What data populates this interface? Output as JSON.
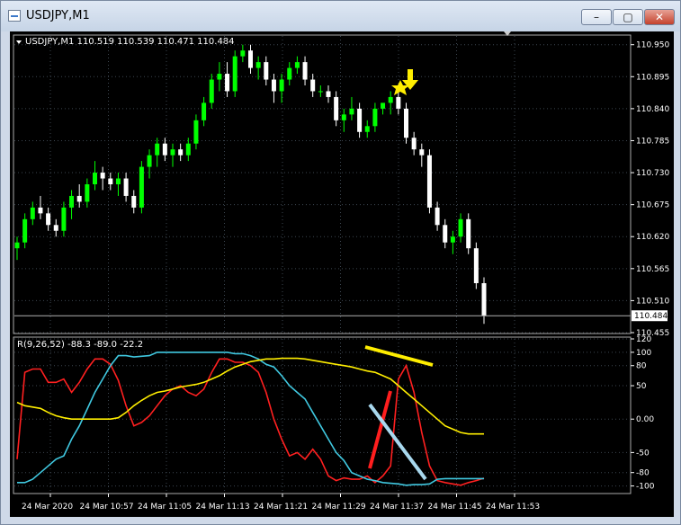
{
  "window": {
    "title": "USDJPY,M1",
    "minimize_glyph": "–",
    "maximize_glyph": "▢",
    "close_glyph": "✕"
  },
  "info_line": "USDJPY,M1  110.519 110.539 110.471 110.484",
  "indicator_label": "R(9,26,52) -88.3 -89.0 -22.2",
  "price_axis_labels": [
    "110.950",
    "110.895",
    "110.840",
    "110.785",
    "110.730",
    "110.675",
    "110.620",
    "110.565",
    "110.510",
    "110.455"
  ],
  "current_price": "110.484",
  "indicator_axis_labels": [
    "120",
    "100",
    "80",
    "50",
    "0.00",
    "-50",
    "-80",
    "-100"
  ],
  "time_axis_labels": [
    "24 Mar 2020",
    "24 Mar 10:57",
    "24 Mar 11:05",
    "24 Mar 11:13",
    "24 Mar 11:21",
    "24 Mar 11:29",
    "24 Mar 11:37",
    "24 Mar 11:45",
    "24 Mar 11:53"
  ],
  "colors": {
    "background": "#000000",
    "bull": "#00ff00",
    "bear": "#ffffff",
    "grid": "#3c4650",
    "axis_text": "#ffffff",
    "line_fast": "#ff2020",
    "line_mid": "#40c8e0",
    "line_slow": "#ffee00",
    "annotation_yellow": "#ffee00",
    "annotation_red": "#ff1e1e",
    "annotation_blue": "#a8d8ee"
  },
  "chart_data": {
    "type": "candlestick",
    "price_ylim": [
      110.455,
      110.965
    ],
    "candles": [
      [
        110.6,
        110.62,
        110.58,
        110.61
      ],
      [
        110.61,
        110.66,
        110.6,
        110.65
      ],
      [
        110.65,
        110.68,
        110.64,
        110.67
      ],
      [
        110.67,
        110.69,
        110.65,
        110.66
      ],
      [
        110.66,
        110.67,
        110.63,
        110.64
      ],
      [
        110.64,
        110.65,
        110.62,
        110.63
      ],
      [
        110.63,
        110.68,
        110.62,
        110.67
      ],
      [
        110.67,
        110.7,
        110.65,
        110.69
      ],
      [
        110.69,
        110.71,
        110.67,
        110.68
      ],
      [
        110.68,
        110.72,
        110.67,
        110.71
      ],
      [
        110.71,
        110.75,
        110.7,
        110.73
      ],
      [
        110.73,
        110.74,
        110.7,
        110.72
      ],
      [
        110.72,
        110.73,
        110.7,
        110.71
      ],
      [
        110.71,
        110.73,
        110.69,
        110.72
      ],
      [
        110.72,
        110.73,
        110.68,
        110.69
      ],
      [
        110.69,
        110.7,
        110.66,
        110.67
      ],
      [
        110.67,
        110.75,
        110.66,
        110.74
      ],
      [
        110.74,
        110.77,
        110.72,
        110.76
      ],
      [
        110.76,
        110.79,
        110.74,
        110.78
      ],
      [
        110.78,
        110.79,
        110.75,
        110.76
      ],
      [
        110.76,
        110.78,
        110.74,
        110.77
      ],
      [
        110.77,
        110.78,
        110.75,
        110.76
      ],
      [
        110.76,
        110.79,
        110.75,
        110.78
      ],
      [
        110.78,
        110.83,
        110.77,
        110.82
      ],
      [
        110.82,
        110.86,
        110.81,
        110.85
      ],
      [
        110.85,
        110.9,
        110.84,
        110.89
      ],
      [
        110.89,
        110.92,
        110.87,
        110.9
      ],
      [
        110.9,
        110.92,
        110.86,
        110.87
      ],
      [
        110.87,
        110.94,
        110.86,
        110.93
      ],
      [
        110.93,
        110.95,
        110.92,
        110.94
      ],
      [
        110.94,
        110.95,
        110.9,
        110.91
      ],
      [
        110.91,
        110.93,
        110.89,
        110.92
      ],
      [
        110.92,
        110.93,
        110.88,
        110.89
      ],
      [
        110.89,
        110.9,
        110.85,
        110.87
      ],
      [
        110.87,
        110.9,
        110.85,
        110.89
      ],
      [
        110.89,
        110.92,
        110.88,
        110.91
      ],
      [
        110.91,
        110.93,
        110.9,
        110.92
      ],
      [
        110.92,
        110.93,
        110.88,
        110.89
      ],
      [
        110.89,
        110.9,
        110.86,
        110.87
      ],
      [
        110.87,
        110.88,
        110.86,
        110.87
      ],
      [
        110.87,
        110.88,
        110.85,
        110.86
      ],
      [
        110.86,
        110.87,
        110.81,
        110.82
      ],
      [
        110.82,
        110.84,
        110.8,
        110.83
      ],
      [
        110.83,
        110.86,
        110.82,
        110.84
      ],
      [
        110.84,
        110.85,
        110.79,
        110.8
      ],
      [
        110.8,
        110.82,
        110.79,
        110.81
      ],
      [
        110.81,
        110.85,
        110.8,
        110.84
      ],
      [
        110.84,
        110.85,
        110.83,
        110.85
      ],
      [
        110.85,
        110.87,
        110.83,
        110.86
      ],
      [
        110.86,
        110.87,
        110.83,
        110.84
      ],
      [
        110.84,
        110.85,
        110.78,
        110.79
      ],
      [
        110.79,
        110.8,
        110.76,
        110.77
      ],
      [
        110.77,
        110.78,
        110.74,
        110.76
      ],
      [
        110.76,
        110.77,
        110.66,
        110.67
      ],
      [
        110.67,
        110.68,
        110.63,
        110.64
      ],
      [
        110.64,
        110.65,
        110.6,
        110.61
      ],
      [
        110.61,
        110.63,
        110.59,
        110.62
      ],
      [
        110.62,
        110.66,
        110.61,
        110.65
      ],
      [
        110.65,
        110.66,
        110.59,
        110.6
      ],
      [
        110.6,
        110.61,
        110.53,
        110.54
      ],
      [
        110.54,
        110.55,
        110.47,
        110.484
      ]
    ],
    "indicator": {
      "name": "R(9,26,52)",
      "ylim": [
        -110,
        120
      ],
      "series": [
        {
          "name": "R9",
          "color": "#ff2020",
          "values": [
            -60,
            70,
            75,
            75,
            55,
            55,
            60,
            40,
            55,
            75,
            90,
            90,
            82,
            58,
            20,
            -10,
            -5,
            5,
            20,
            35,
            45,
            50,
            40,
            35,
            45,
            70,
            90,
            90,
            85,
            85,
            80,
            70,
            40,
            0,
            -30,
            -55,
            -50,
            -60,
            -45,
            -60,
            -85,
            -92,
            -88,
            -90,
            -90,
            -85,
            -95,
            -85,
            -70,
            60,
            80,
            40,
            -20,
            -70,
            -92,
            -95,
            -97,
            -99,
            -95,
            -92,
            -88.3
          ]
        },
        {
          "name": "R26",
          "color": "#40c8e0",
          "values": [
            -95,
            -95,
            -90,
            -80,
            -70,
            -60,
            -55,
            -30,
            -10,
            15,
            40,
            60,
            80,
            95,
            95,
            93,
            94,
            95,
            100,
            100,
            100,
            100,
            100,
            100,
            100,
            100,
            100,
            100,
            98,
            98,
            95,
            90,
            82,
            78,
            65,
            50,
            40,
            30,
            10,
            -10,
            -30,
            -50,
            -62,
            -80,
            -85,
            -90,
            -92,
            -95,
            -96,
            -97,
            -99,
            -98,
            -98,
            -97,
            -90,
            -89,
            -89.0,
            -89.0,
            -89.0,
            -89.0,
            -89.0
          ]
        },
        {
          "name": "R52",
          "color": "#ffee00",
          "values": [
            25,
            20,
            18,
            16,
            10,
            5,
            2,
            0,
            0,
            0,
            0,
            0,
            0,
            2,
            10,
            20,
            28,
            35,
            40,
            42,
            45,
            48,
            50,
            52,
            55,
            60,
            65,
            72,
            78,
            82,
            86,
            88,
            90,
            90,
            91,
            91,
            91,
            90,
            88,
            86,
            84,
            82,
            80,
            78,
            75,
            72,
            70,
            65,
            60,
            50,
            40,
            30,
            20,
            10,
            0,
            -10,
            -15,
            -20,
            -22.2,
            -22.2,
            -22.2
          ]
        }
      ]
    }
  }
}
